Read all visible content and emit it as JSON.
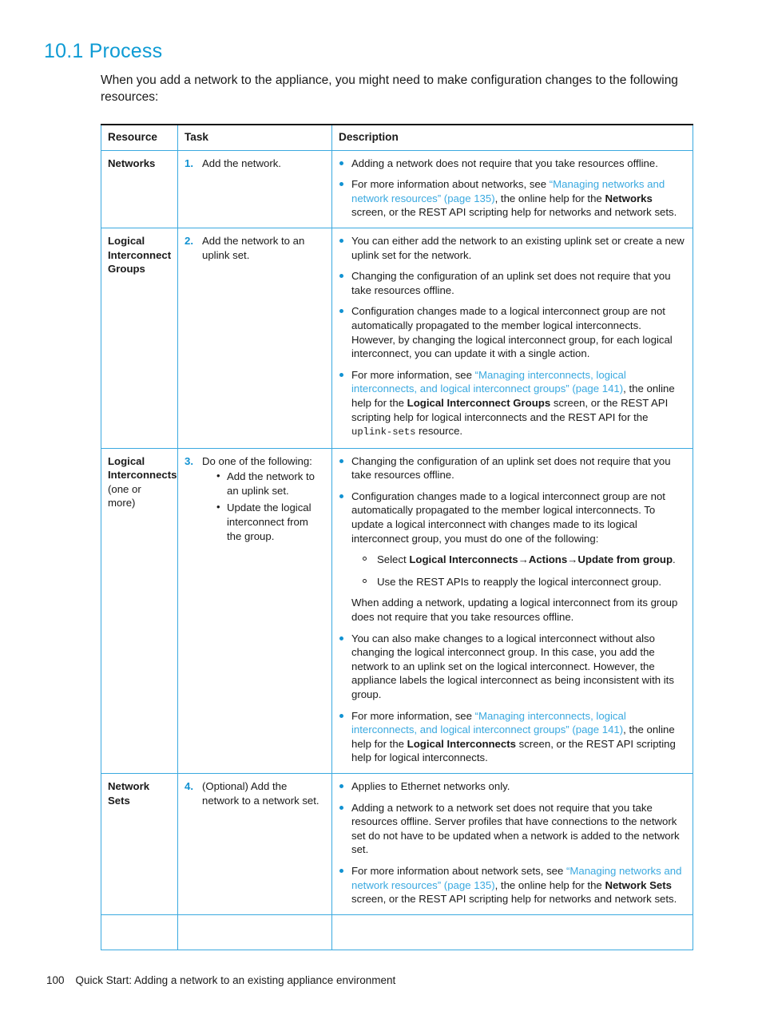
{
  "section": {
    "number": "10.1",
    "title": "Process",
    "heading": "10.1 Process",
    "intro": "When you add a network to the appliance, you might need to make configuration changes to the following resources:"
  },
  "colors": {
    "heading_blue": "#0e9bd4",
    "link_blue": "#3aa9e0",
    "bullet_blue": "#1192d2",
    "rule_blue": "#3aa9e0",
    "top_rule": "#111111"
  },
  "table": {
    "headers": {
      "resource": "Resource",
      "task": "Task",
      "description": "Description"
    },
    "rows": [
      {
        "resource": "Networks",
        "resource_note": "",
        "step_number": "1.",
        "step_text": "Add the network.",
        "substeps": [],
        "description": [
          {
            "parts": [
              {
                "t": "Adding a network does not require that you take resources offline.",
                "s": "normal"
              }
            ]
          },
          {
            "parts": [
              {
                "t": "For more information about networks, see ",
                "s": "normal"
              },
              {
                "t": "“Managing networks and network resources” (page 135)",
                "s": "link"
              },
              {
                "t": ", the online help for the ",
                "s": "normal"
              },
              {
                "t": "Networks",
                "s": "bold"
              },
              {
                "t": " screen, or the REST API scripting help for networks and network sets.",
                "s": "normal"
              }
            ]
          }
        ]
      },
      {
        "resource": "Logical Interconnect Groups",
        "resource_note": "",
        "step_number": "2.",
        "step_text": "Add the network to an uplink set.",
        "substeps": [],
        "description": [
          {
            "parts": [
              {
                "t": "You can either add the network to an existing uplink set or create a new uplink set for the network.",
                "s": "normal"
              }
            ]
          },
          {
            "parts": [
              {
                "t": "Changing the configuration of an uplink set does not require that you take resources offline.",
                "s": "normal"
              }
            ]
          },
          {
            "parts": [
              {
                "t": "Configuration changes made to a logical interconnect group are not automatically propagated to the member logical interconnects. However, by changing the logical interconnect group, for each logical interconnect, you can update it with a single action.",
                "s": "normal"
              }
            ]
          },
          {
            "parts": [
              {
                "t": "For more information, see ",
                "s": "normal"
              },
              {
                "t": "“Managing interconnects, logical interconnects, and logical interconnect groups” (page 141)",
                "s": "link"
              },
              {
                "t": ", the online help for the ",
                "s": "normal"
              },
              {
                "t": "Logical Interconnect Groups",
                "s": "bold"
              },
              {
                "t": " screen, or the REST API scripting help for logical interconnects and the REST API for the ",
                "s": "normal"
              },
              {
                "t": "uplink-sets",
                "s": "mono"
              },
              {
                "t": " resource.",
                "s": "normal"
              }
            ]
          }
        ]
      },
      {
        "resource": "Logical Interconnects",
        "resource_note": "(one or more)",
        "step_number": "3.",
        "step_text": "Do one of the following:",
        "substeps": [
          "Add the network to an uplink set.",
          "Update the logical interconnect from the group."
        ],
        "description": [
          {
            "parts": [
              {
                "t": "Changing the configuration of an uplink set does not require that you take resources offline.",
                "s": "normal"
              }
            ]
          },
          {
            "parts": [
              {
                "t": "Configuration changes made to a logical interconnect group are not automatically propagated to the member logical interconnects. To update a logical interconnect with changes made to its logical interconnect group, you must do one of the following:",
                "s": "normal"
              }
            ],
            "circles": [
              {
                "parts": [
                  {
                    "t": "Select ",
                    "s": "normal"
                  },
                  {
                    "t": "Logical Interconnects→Actions→Update from group",
                    "s": "bold"
                  },
                  {
                    "t": ".",
                    "s": "normal"
                  }
                ]
              },
              {
                "parts": [
                  {
                    "t": "Use the REST APIs to reapply the logical interconnect group.",
                    "s": "normal"
                  }
                ]
              }
            ],
            "after": [
              {
                "t": "When adding a network, updating a logical interconnect from its group does not require that you take resources offline.",
                "s": "normal"
              }
            ]
          },
          {
            "parts": [
              {
                "t": "You can also make changes to a logical interconnect without also changing the logical interconnect group. In this case, you add the network to an uplink set on the logical interconnect. However, the appliance labels the logical interconnect as being inconsistent with its group.",
                "s": "normal"
              }
            ]
          },
          {
            "parts": [
              {
                "t": "For more information, see ",
                "s": "normal"
              },
              {
                "t": "“Managing interconnects, logical interconnects, and logical interconnect groups” (page 141)",
                "s": "link"
              },
              {
                "t": ", the online help for the ",
                "s": "normal"
              },
              {
                "t": "Logical Interconnects",
                "s": "bold"
              },
              {
                "t": " screen, or the REST API scripting help for logical interconnects.",
                "s": "normal"
              }
            ]
          }
        ]
      },
      {
        "resource": "Network Sets",
        "resource_note": "",
        "step_number": "4.",
        "step_text": "(Optional) Add the network to a network set.",
        "substeps": [],
        "description": [
          {
            "parts": [
              {
                "t": "Applies to Ethernet networks only.",
                "s": "normal"
              }
            ]
          },
          {
            "parts": [
              {
                "t": "Adding a network to a network set does not require that you take resources offline. Server profiles that have connections to the network set do not have to be updated when a network is added to the network set.",
                "s": "normal"
              }
            ]
          },
          {
            "parts": [
              {
                "t": "For more information about network sets, see ",
                "s": "normal"
              },
              {
                "t": "“Managing networks and network resources” (page 135)",
                "s": "link"
              },
              {
                "t": ", the online help for the ",
                "s": "normal"
              },
              {
                "t": "Network Sets",
                "s": "bold"
              },
              {
                "t": " screen, or the REST API scripting help for networks and network sets.",
                "s": "normal"
              }
            ]
          }
        ]
      },
      {
        "resource": "",
        "resource_note": "",
        "step_number": "",
        "step_text": "",
        "substeps": [],
        "description": [],
        "partial": true
      }
    ]
  },
  "footer": {
    "page_number": "100",
    "text": "Quick Start: Adding a network to an existing appliance environment"
  }
}
